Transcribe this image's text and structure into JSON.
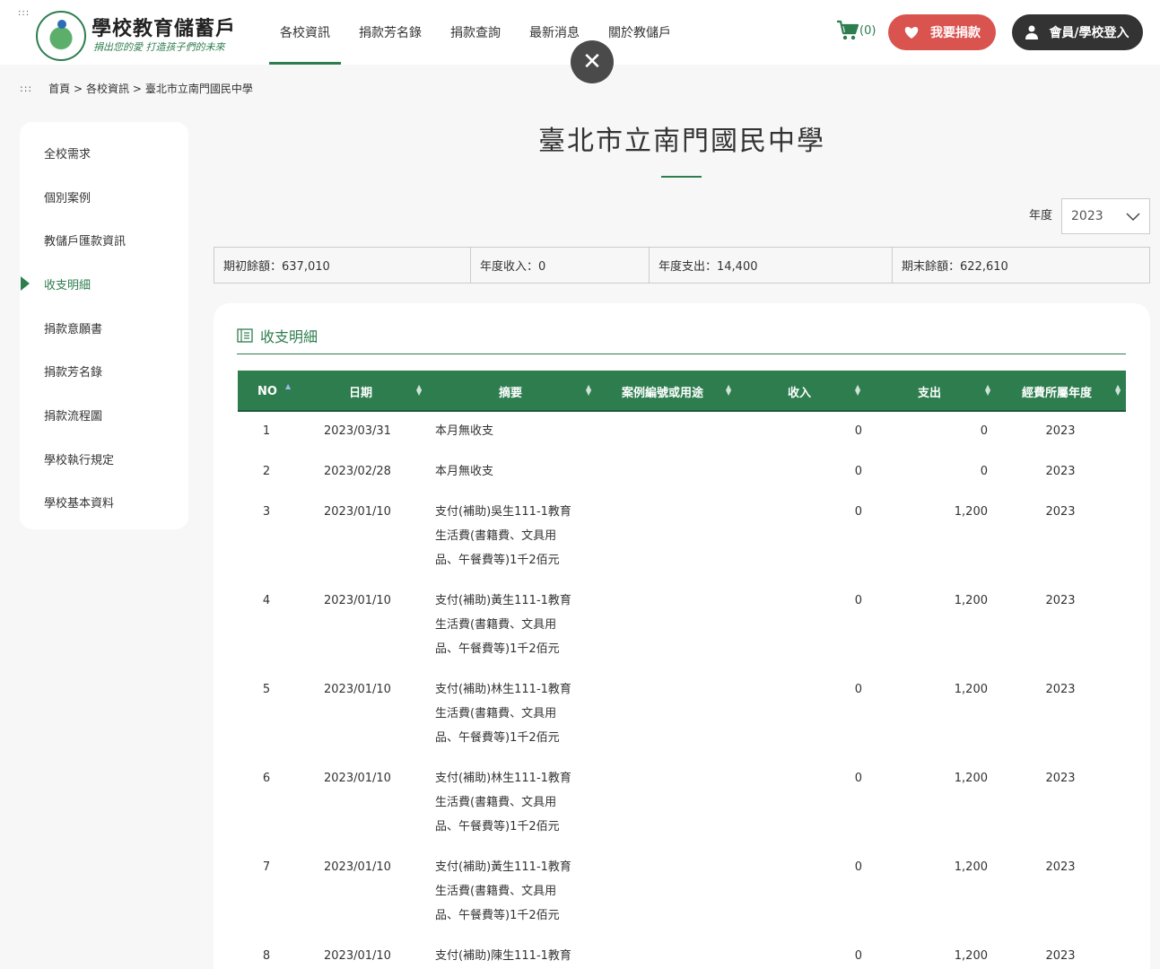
{
  "header": {
    "acc_marker": ":::",
    "site_title": "學校教育儲蓄戶",
    "site_slogan": "捐出您的愛 打造孩子們的未來",
    "nav": [
      "各校資訊",
      "捐款芳名錄",
      "捐款查詢",
      "最新消息",
      "關於教儲戶"
    ],
    "cart_count": "(0)",
    "donate_label": "我要捐款",
    "login_label": "會員/學校登入",
    "close_symbol": "✕"
  },
  "breadcrumb": {
    "acc_marker": ":::",
    "items": [
      "首頁 >",
      "各校資訊 >",
      "臺北市立南門國民中學"
    ]
  },
  "sidebar": {
    "items": [
      "全校需求",
      "個別案例",
      "教儲戶匯款資訊",
      "收支明細",
      "捐款意願書",
      "捐款芳名錄",
      "捐款流程圖",
      "學校執行規定",
      "學校基本資料"
    ],
    "active_index": 3
  },
  "main": {
    "school_title": "臺北市立南門國民中學",
    "year_label": "年度",
    "year_value": "2023",
    "summary": [
      "期初餘額：637,010",
      "年度收入：0",
      "年度支出：14,400",
      "期末餘額：622,610"
    ],
    "panel_title": "收支明細",
    "table": {
      "headers": [
        "NO",
        "日期",
        "摘要",
        "案例編號或用途",
        "收入",
        "支出",
        "經費所屬年度"
      ],
      "rows": [
        {
          "no": "1",
          "date": "2023/03/31",
          "summary": [
            "本月無收支"
          ],
          "case": "",
          "income": "0",
          "expense": "0",
          "year": "2023"
        },
        {
          "no": "2",
          "date": "2023/02/28",
          "summary": [
            "本月無收支"
          ],
          "case": "",
          "income": "0",
          "expense": "0",
          "year": "2023"
        },
        {
          "no": "3",
          "date": "2023/01/10",
          "summary": [
            "支付(補助)吳生111-1教育",
            "生活費(書籍費、文具用",
            "品、午餐費等)1千2佰元"
          ],
          "case": "",
          "income": "0",
          "expense": "1,200",
          "year": "2023"
        },
        {
          "no": "4",
          "date": "2023/01/10",
          "summary": [
            "支付(補助)黃生111-1教育",
            "生活費(書籍費、文具用",
            "品、午餐費等)1千2佰元"
          ],
          "case": "",
          "income": "0",
          "expense": "1,200",
          "year": "2023"
        },
        {
          "no": "5",
          "date": "2023/01/10",
          "summary": [
            "支付(補助)林生111-1教育",
            "生活費(書籍費、文具用",
            "品、午餐費等)1千2佰元"
          ],
          "case": "",
          "income": "0",
          "expense": "1,200",
          "year": "2023"
        },
        {
          "no": "6",
          "date": "2023/01/10",
          "summary": [
            "支付(補助)林生111-1教育",
            "生活費(書籍費、文具用",
            "品、午餐費等)1千2佰元"
          ],
          "case": "",
          "income": "0",
          "expense": "1,200",
          "year": "2023"
        },
        {
          "no": "7",
          "date": "2023/01/10",
          "summary": [
            "支付(補助)黃生111-1教育",
            "生活費(書籍費、文具用",
            "品、午餐費等)1千2佰元"
          ],
          "case": "",
          "income": "0",
          "expense": "1,200",
          "year": "2023"
        },
        {
          "no": "8",
          "date": "2023/01/10",
          "summary": [
            "支付(補助)陳生111-1教育"
          ],
          "case": "",
          "income": "0",
          "expense": "1,200",
          "year": "2023"
        }
      ]
    }
  },
  "colors": {
    "accent": "#2e7d4f",
    "donate": "#d9534f",
    "login": "#333333",
    "close": "#4a4a4a"
  }
}
